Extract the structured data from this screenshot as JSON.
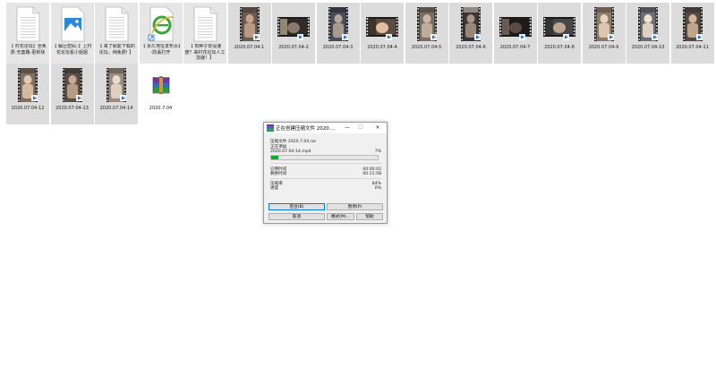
{
  "explorer": {
    "files": [
      {
        "kind": "txt",
        "label": "【 村花论坛】全免费-无套路-更新快"
      },
      {
        "kind": "img",
        "label": "【 解压密码：】上村花论坛看小姐姐"
      },
      {
        "kind": "txt",
        "label": "【 来了就能下载的论坛，纯免费! 】"
      },
      {
        "kind": "ie",
        "label": "【 永久地址发布页】-防丢打开"
      },
      {
        "kind": "txt",
        "label": "【 有种子却没速度？来村花论坛人工加速！】"
      },
      {
        "kind": "video",
        "label": "2020.07.04-1"
      },
      {
        "kind": "video",
        "label": "2020.07.04-2"
      },
      {
        "kind": "video",
        "label": "2020.07.04-3"
      },
      {
        "kind": "video",
        "label": "2020.07.04-4"
      },
      {
        "kind": "video",
        "label": "2020.07.04-5"
      },
      {
        "kind": "video",
        "label": "2020.07.04-6"
      },
      {
        "kind": "video",
        "label": "2020.07.04-7"
      },
      {
        "kind": "video",
        "label": "2020.07.04-8"
      },
      {
        "kind": "video",
        "label": "2020.07.04-9"
      },
      {
        "kind": "video",
        "label": "2020.07.04-10"
      },
      {
        "kind": "video",
        "label": "2020.07.04-11"
      },
      {
        "kind": "video",
        "label": "2020.07.04-12"
      },
      {
        "kind": "video",
        "label": "2020.07.04-13"
      },
      {
        "kind": "video",
        "label": "2020.07.04-14"
      },
      {
        "kind": "rar",
        "label": "2020.7.04"
      }
    ]
  },
  "dialog": {
    "title": "正在创建压缩文件 2020....",
    "minimize": "—",
    "maximize": "☐",
    "close": "✕",
    "archive_line": "压缩文件 2020.7.04.rar",
    "adding_label": "正在添加",
    "current_file": "2020.07.04-14.mp4",
    "file_percent": "7%",
    "file_progress": 0.07,
    "elapsed_label": "已用时间",
    "elapsed_value": "00:00:02",
    "remaining_label": "剩余时间",
    "remaining_value": "00:11:58",
    "ratio_label": "压缩率",
    "ratio_value": "84%",
    "progress_label": "进度",
    "progress_value": "0%",
    "btn_background": "后台(B)",
    "btn_pause": "暂停(P)",
    "btn_cancel": "取消",
    "btn_mode": "模式(M)...",
    "btn_help": "帮助"
  }
}
